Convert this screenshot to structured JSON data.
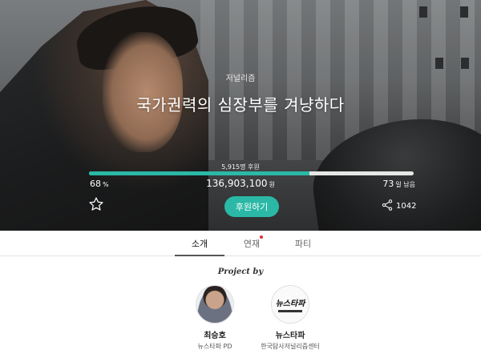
{
  "project": {
    "category": "저널리즘",
    "title": "국가권력의 심장부를 겨냥하다"
  },
  "funding": {
    "supporters_label": "5,915명 후원",
    "progress_fraction": 0.68,
    "percent": "68",
    "percent_unit": "%",
    "amount": "136,903,100",
    "amount_unit": "원",
    "days": "73",
    "days_unit": "일 남음"
  },
  "actions": {
    "support_label": "후원하기",
    "share_count": "1042"
  },
  "tabs": [
    {
      "label": "소개",
      "active": true
    },
    {
      "label": "연재",
      "has_dot": true
    },
    {
      "label": "파티"
    }
  ],
  "project_by": "Project by",
  "creators": [
    {
      "name": "최승호",
      "role": "뉴스타파 PD"
    },
    {
      "name": "뉴스타파",
      "role": "한국탐사저널리즘센터",
      "logo_text": "뉴스타파"
    }
  ],
  "colors": {
    "accent": "#2bb8a6",
    "notification_dot": "#e0312f"
  }
}
